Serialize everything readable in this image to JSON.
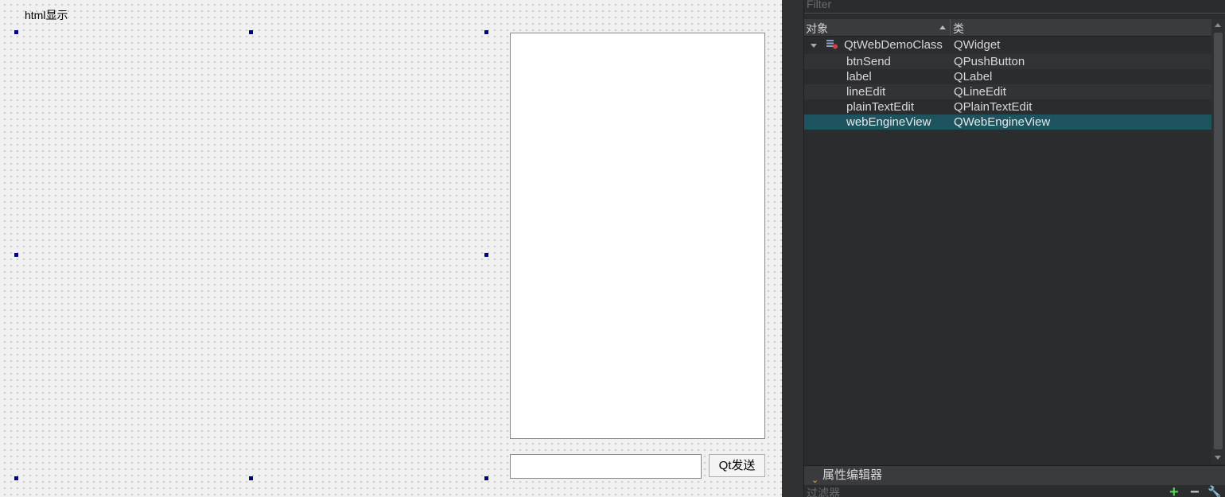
{
  "form": {
    "label_text": "html显示",
    "send_button": "Qt发送",
    "line_edit_value": "",
    "plain_text_value": ""
  },
  "inspector": {
    "filter_placeholder": "Filter",
    "header": {
      "object": "对象",
      "class": "类"
    },
    "root": {
      "name": "QtWebDemoClass",
      "class": "QWidget"
    },
    "children": [
      {
        "name": "btnSend",
        "class": "QPushButton"
      },
      {
        "name": "label",
        "class": "QLabel"
      },
      {
        "name": "lineEdit",
        "class": "QLineEdit"
      },
      {
        "name": "plainTextEdit",
        "class": "QPlainTextEdit"
      },
      {
        "name": "webEngineView",
        "class": "QWebEngineView"
      }
    ],
    "selected": "webEngineView"
  },
  "property_editor": {
    "title": "属性编辑器",
    "filter_placeholder": "过滤器"
  },
  "colors": {
    "selection": "#1d5460",
    "handle": "#000080",
    "add_icon": "#4bd34b"
  }
}
